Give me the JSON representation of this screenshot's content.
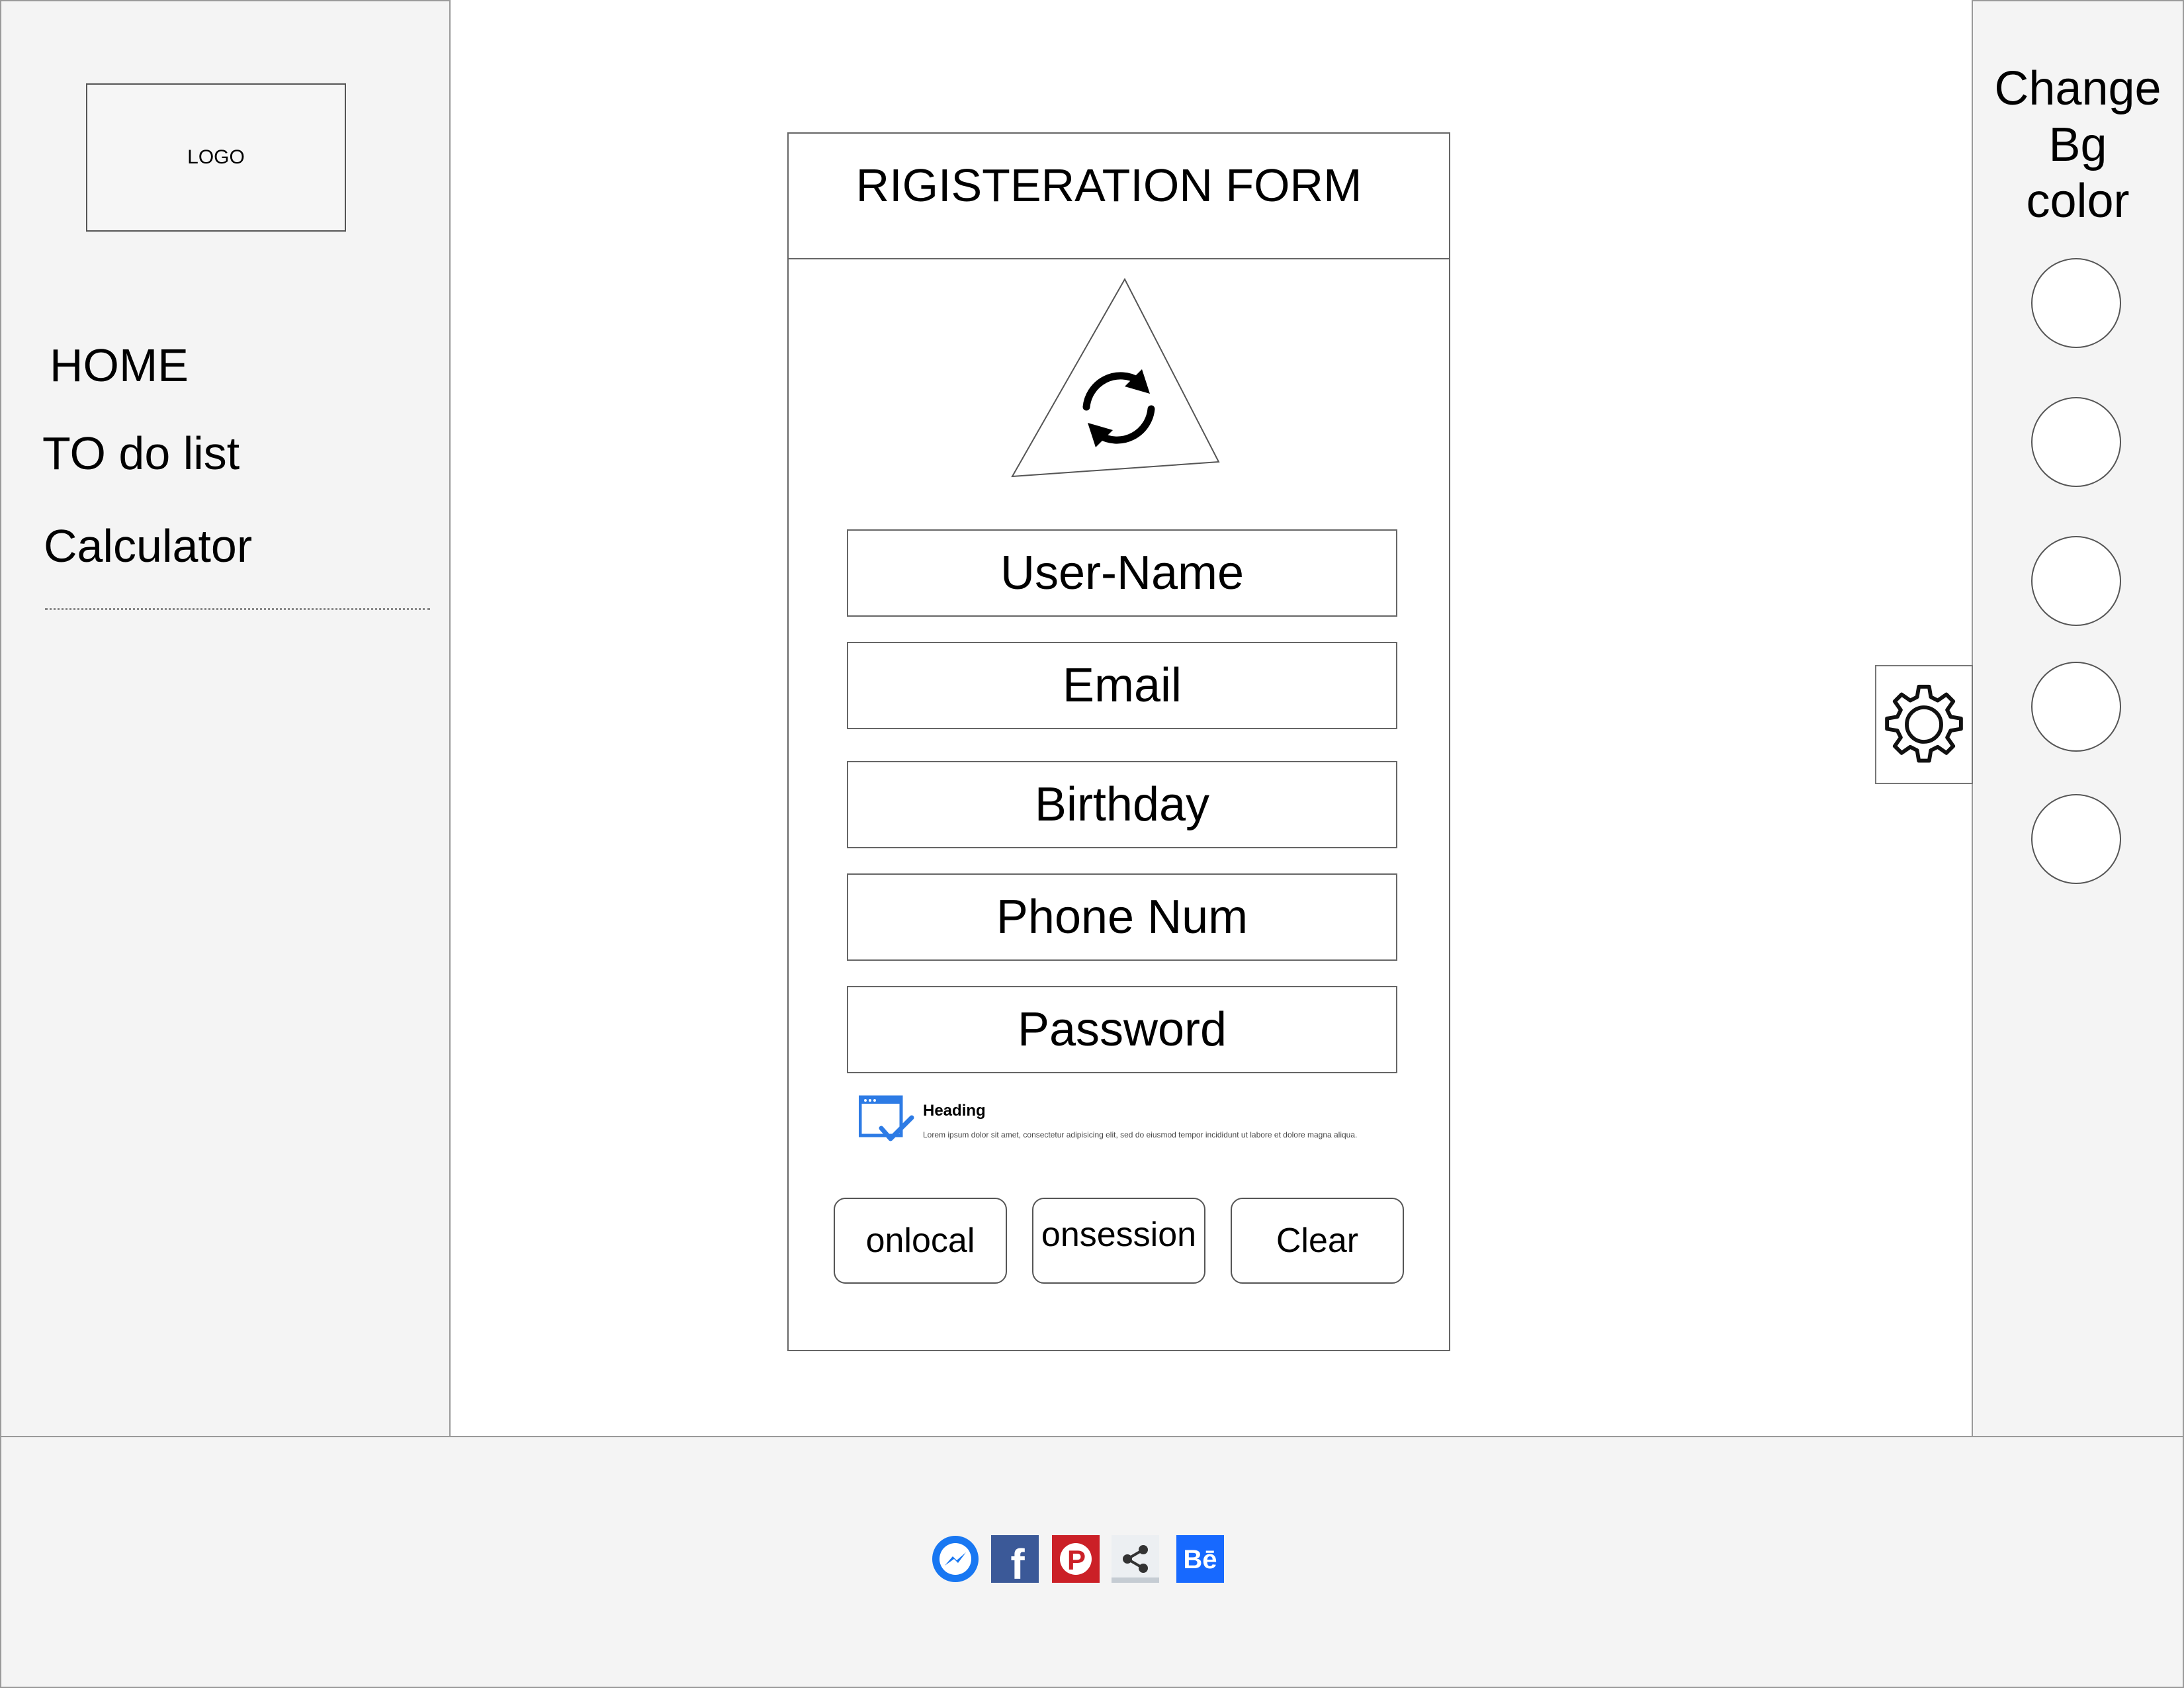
{
  "sidebar": {
    "logo_label": "LOGO",
    "nav_items": [
      {
        "label": "HOME"
      },
      {
        "label": "TO do list"
      },
      {
        "label": "Calculator"
      }
    ]
  },
  "right_panel": {
    "title_line1": "Change",
    "title_line2": "Bg",
    "title_line3": "color",
    "swatch_count": 5
  },
  "form": {
    "title": "RIGISTERATION FORM",
    "avatar_icon": "refresh-icon",
    "fields": [
      {
        "label": "User-Name"
      },
      {
        "label": "Email"
      },
      {
        "label": "Birthday"
      },
      {
        "label": "Phone Num"
      },
      {
        "label": "Password"
      }
    ],
    "notice": {
      "icon": "window-check-icon",
      "heading": "Heading",
      "text": "Lorem ipsum dolor sit amet, consectetur adipisicing elit, sed do eiusmod tempor incididunt ut labore et dolore magna aliqua."
    },
    "buttons": [
      {
        "label": "onlocal"
      },
      {
        "label": "onsession"
      },
      {
        "label": "Clear"
      }
    ]
  },
  "settings": {
    "icon": "gear-icon"
  },
  "footer": {
    "social_icons": [
      "messenger-icon",
      "facebook-icon",
      "pinterest-icon",
      "share-icon",
      "behance-icon"
    ]
  },
  "colors": {
    "panel_bg": "#f4f4f4",
    "border": "#9a9a9a",
    "messenger": "#1877f2",
    "facebook": "#3b5998",
    "pinterest": "#cb2027",
    "behance": "#1769ff",
    "notice_icon": "#2d7be5"
  }
}
